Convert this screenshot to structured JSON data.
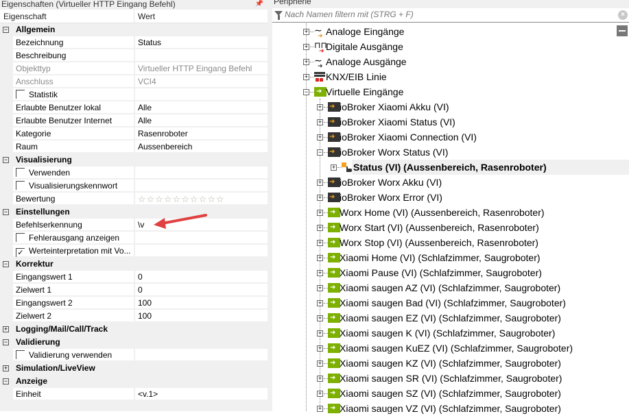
{
  "left_panel": {
    "title": "Eigenschaften (Virtueller HTTP Eingang Befehl)",
    "col_property": "Eigenschaft",
    "col_value": "Wert",
    "rows": [
      {
        "type": "group",
        "label": "Allgemein",
        "expanded": true
      },
      {
        "type": "prop",
        "label": "Bezeichnung",
        "value": "Status"
      },
      {
        "type": "prop",
        "label": "Beschreibung",
        "value": ""
      },
      {
        "type": "prop",
        "label": "Objekttyp",
        "value": "Virtueller HTTP Eingang Befehl",
        "disabled": true
      },
      {
        "type": "prop",
        "label": "Anschluss",
        "value": "VCI4",
        "disabled": true
      },
      {
        "type": "check",
        "label": "Statistik",
        "checked": false
      },
      {
        "type": "prop",
        "label": "Erlaubte Benutzer lokal",
        "value": "Alle"
      },
      {
        "type": "prop",
        "label": "Erlaubte Benutzer Internet",
        "value": "Alle"
      },
      {
        "type": "prop",
        "label": "Kategorie",
        "value": "Rasenroboter"
      },
      {
        "type": "prop",
        "label": "Raum",
        "value": "Aussenbereich"
      },
      {
        "type": "group",
        "label": "Visualisierung",
        "expanded": true
      },
      {
        "type": "check",
        "label": "Verwenden",
        "checked": false
      },
      {
        "type": "check",
        "label": "Visualisierungskennwort",
        "checked": false
      },
      {
        "type": "stars",
        "label": "Bewertung",
        "rating": 0,
        "max": 10
      },
      {
        "type": "group",
        "label": "Einstellungen",
        "expanded": true
      },
      {
        "type": "prop",
        "label": "Befehlserkennung",
        "value": "\\v"
      },
      {
        "type": "check",
        "label": "Fehlerausgang anzeigen",
        "checked": false
      },
      {
        "type": "check",
        "label": "Werteinterpretation mit Vo...",
        "checked": true
      },
      {
        "type": "group",
        "label": "Korrektur",
        "expanded": true
      },
      {
        "type": "prop",
        "label": "Eingangswert 1",
        "value": "0"
      },
      {
        "type": "prop",
        "label": "Zielwert 1",
        "value": "0"
      },
      {
        "type": "prop",
        "label": "Eingangswert 2",
        "value": "100"
      },
      {
        "type": "prop",
        "label": "Zielwert 2",
        "value": "100"
      },
      {
        "type": "group",
        "label": "Logging/Mail/Call/Track",
        "expanded": false
      },
      {
        "type": "group",
        "label": "Validierung",
        "expanded": true
      },
      {
        "type": "check",
        "label": "Validierung verwenden",
        "checked": false
      },
      {
        "type": "group",
        "label": "Simulation/LiveView",
        "expanded": false
      },
      {
        "type": "group",
        "label": "Anzeige",
        "expanded": true
      },
      {
        "type": "prop",
        "label": "Einheit",
        "value": "<v.1>"
      }
    ]
  },
  "right_panel": {
    "title": "Peripherie",
    "filter_placeholder": "Nach Namen filtern mit (STRG + F)",
    "nodes": [
      {
        "level": 1,
        "icon": "analog-input-icon",
        "label": "Analoge Eingänge",
        "expanded": false
      },
      {
        "level": 1,
        "icon": "digital-output-icon",
        "label": "Digitale Ausgänge",
        "expanded": false
      },
      {
        "level": 1,
        "icon": "analog-output-icon",
        "label": "Analoge Ausgänge",
        "expanded": false
      },
      {
        "level": 1,
        "icon": "knx-line-icon",
        "label": "KNX/EIB Linie",
        "expanded": false
      },
      {
        "level": 1,
        "icon": "virtual-input-icon",
        "label": "Virtuelle Eingänge",
        "expanded": true
      },
      {
        "level": 2,
        "icon": "iobroker-input-icon",
        "label": "ioBroker Xiaomi Akku (VI)",
        "expanded": false
      },
      {
        "level": 2,
        "icon": "iobroker-input-icon",
        "label": "ioBroker Xiaomi Status (VI)",
        "expanded": false
      },
      {
        "level": 2,
        "icon": "iobroker-input-icon",
        "label": "ioBroker Xiaomi Connection (VI)",
        "expanded": false
      },
      {
        "level": 2,
        "icon": "iobroker-input-icon",
        "label": "ioBroker Worx Status (VI)",
        "expanded": true
      },
      {
        "level": 3,
        "icon": "status-command-icon",
        "label": "Status (VI) (Aussenbereich, Rasenroboter)",
        "expanded": false,
        "selected": true
      },
      {
        "level": 2,
        "icon": "iobroker-input-icon",
        "label": "ioBroker Worx Akku (VI)",
        "expanded": false
      },
      {
        "level": 2,
        "icon": "iobroker-input-icon",
        "label": "ioBroker Worx Error (VI)",
        "expanded": false
      },
      {
        "level": 2,
        "icon": "virtual-input-icon",
        "label": "Worx Home (VI) (Aussenbereich, Rasenroboter)",
        "expanded": false
      },
      {
        "level": 2,
        "icon": "virtual-input-icon",
        "label": "Worx Start (VI) (Aussenbereich, Rasenroboter)",
        "expanded": false
      },
      {
        "level": 2,
        "icon": "virtual-input-icon",
        "label": "Worx Stop (VI) (Aussenbereich, Rasenroboter)",
        "expanded": false
      },
      {
        "level": 2,
        "icon": "virtual-input-icon",
        "label": "Xiaomi Home (VI) (Schlafzimmer, Saugroboter)",
        "expanded": false
      },
      {
        "level": 2,
        "icon": "virtual-input-icon",
        "label": "Xiaomi Pause (VI) (Schlafzimmer, Saugroboter)",
        "expanded": false
      },
      {
        "level": 2,
        "icon": "virtual-input-icon",
        "label": "Xiaomi saugen AZ (VI) (Schlafzimmer, Saugroboter)",
        "expanded": false
      },
      {
        "level": 2,
        "icon": "virtual-input-icon",
        "label": "Xiaomi saugen Bad (VI) (Schlafzimmer, Saugroboter)",
        "expanded": false
      },
      {
        "level": 2,
        "icon": "virtual-input-icon",
        "label": "Xiaomi saugen EZ (VI) (Schlafzimmer, Saugroboter)",
        "expanded": false
      },
      {
        "level": 2,
        "icon": "virtual-input-icon",
        "label": "Xiaomi saugen K (VI) (Schlafzimmer, Saugroboter)",
        "expanded": false
      },
      {
        "level": 2,
        "icon": "virtual-input-icon",
        "label": "Xiaomi saugen KuEZ (VI) (Schlafzimmer, Saugroboter)",
        "expanded": false
      },
      {
        "level": 2,
        "icon": "virtual-input-icon",
        "label": "Xiaomi saugen KZ (VI) (Schlafzimmer, Saugroboter)",
        "expanded": false
      },
      {
        "level": 2,
        "icon": "virtual-input-icon",
        "label": "Xiaomi saugen SR (VI) (Schlafzimmer, Saugroboter)",
        "expanded": false
      },
      {
        "level": 2,
        "icon": "virtual-input-icon",
        "label": "Xiaomi saugen SZ (VI) (Schlafzimmer, Saugroboter)",
        "expanded": false
      },
      {
        "level": 2,
        "icon": "virtual-input-icon",
        "label": "Xiaomi saugen VZ (VI) (Schlafzimmer, Saugroboter)",
        "expanded": false
      }
    ]
  },
  "colors": {
    "virtual_green": "#7db000",
    "iobroker_dark": "#333333",
    "orange": "#f5a020",
    "annotation_red": "#e04040"
  }
}
